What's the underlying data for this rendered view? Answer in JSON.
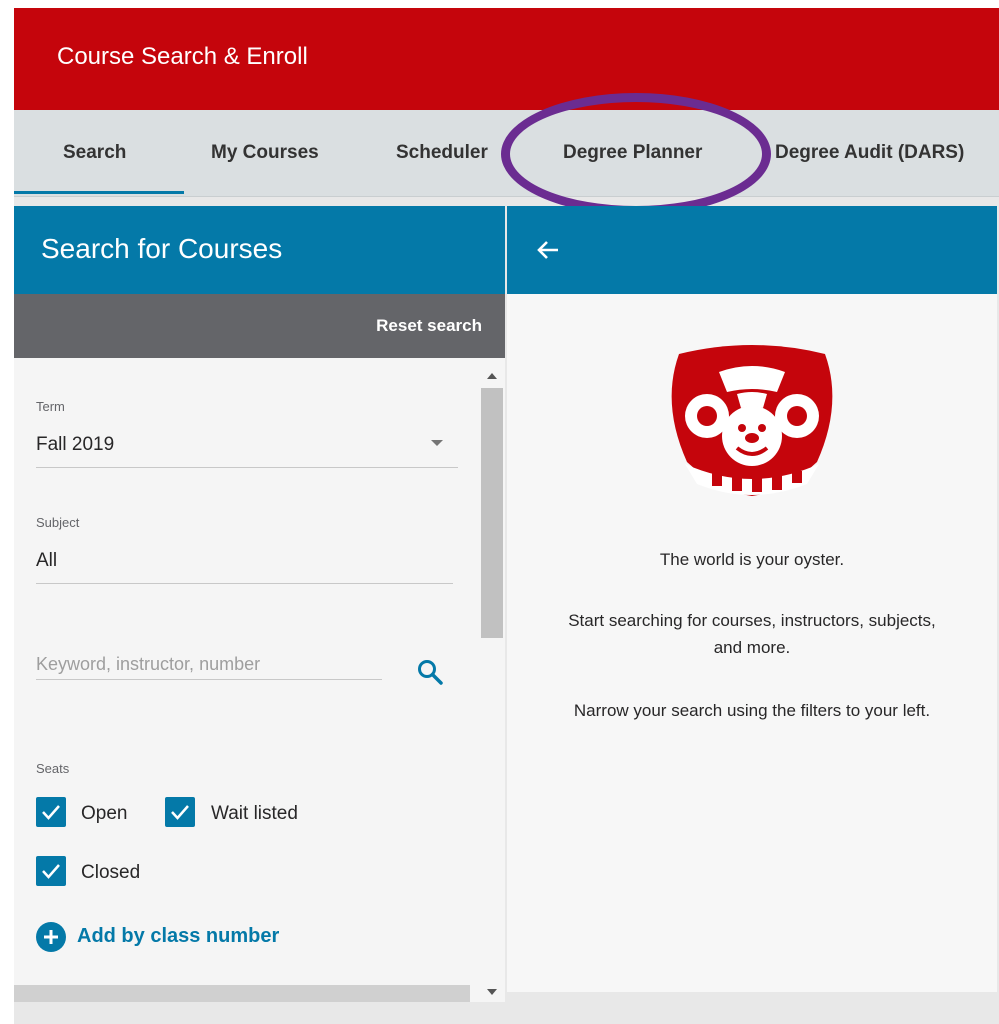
{
  "app": {
    "title": "Course Search & Enroll"
  },
  "tabs": [
    {
      "label": "Search",
      "active": true
    },
    {
      "label": "My Courses"
    },
    {
      "label": "Scheduler"
    },
    {
      "label": "Degree Planner",
      "highlighted": true
    },
    {
      "label": "Degree Audit (DARS)"
    }
  ],
  "search_panel": {
    "title": "Search for Courses",
    "reset_label": "Reset search",
    "term": {
      "label": "Term",
      "value": "Fall 2019"
    },
    "subject": {
      "label": "Subject",
      "value": "All"
    },
    "keyword": {
      "placeholder": "Keyword, instructor, number",
      "value": ""
    },
    "seats": {
      "label": "Seats",
      "options": [
        {
          "label": "Open",
          "checked": true
        },
        {
          "label": "Wait listed",
          "checked": true
        },
        {
          "label": "Closed",
          "checked": true
        }
      ]
    },
    "add_by_class_number": "Add by class number"
  },
  "results_panel": {
    "back_icon": "arrow-left-icon",
    "logo_icon": "bucky-badger-logo",
    "message_title": "The world is your oyster.",
    "message_body": "Start searching for courses, instructors, subjects, and more.",
    "message_hint": "Narrow your search using the filters to your left."
  },
  "colors": {
    "header_red": "#c5050c",
    "accent_blue": "#0479a8",
    "highlight_purple": "#6b2c91",
    "reset_bar_gray": "#646569"
  }
}
